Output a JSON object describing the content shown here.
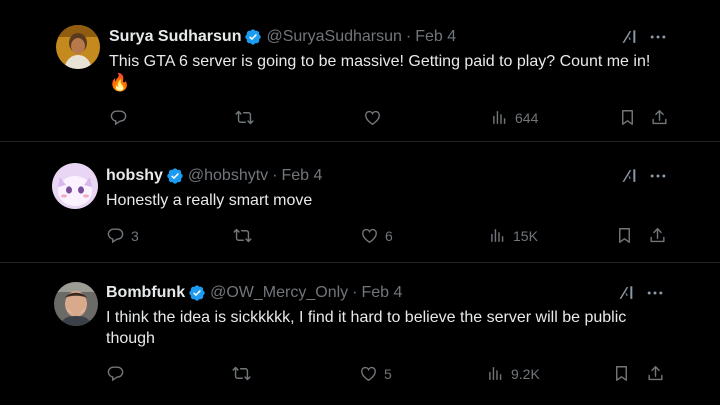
{
  "tweets": [
    {
      "name": "Surya Sudharsun",
      "handle": "@SuryaSudharsun",
      "date": "Feb 4",
      "text": "This GTA 6 server is going to be massive! Getting paid to play? Count me in!",
      "text2": "🔥",
      "replies": "",
      "retweets": "",
      "likes": "",
      "views": "644"
    },
    {
      "name": "hobshy",
      "handle": "@hobshytv",
      "date": "Feb 4",
      "text": "Honestly a really smart move",
      "replies": "3",
      "retweets": "",
      "likes": "6",
      "views": "15K"
    },
    {
      "name": "Bombfunk",
      "handle": "@OW_Mercy_Only",
      "date": "Feb 4",
      "text": "I think the idea is sickkkkk, I find it hard to believe the server will be public though",
      "replies": "",
      "retweets": "",
      "likes": "5",
      "views": "9.2K"
    }
  ],
  "separator": "·",
  "colors": {
    "background": "#000000",
    "text": "#e7e9ea",
    "secondary": "#71767b",
    "verified": "#1d9bf0"
  }
}
